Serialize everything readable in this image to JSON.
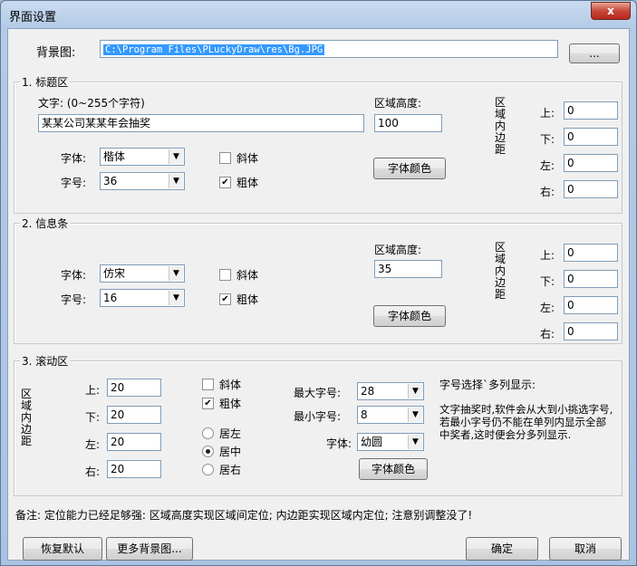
{
  "window": {
    "title": "界面设置",
    "close": "x"
  },
  "background": {
    "label": "背景图:",
    "path": "C:\\Program Files\\PLuckyDraw\\res\\Bg.JPG",
    "browse": "..."
  },
  "title_area": {
    "group": "1. 标题区",
    "text_label": "文字: (0~255个字符)",
    "text_value": "某某公司某某年会抽奖",
    "height_label": "区域高度:",
    "height_value": "100",
    "font_label": "字体:",
    "font_value": "楷体",
    "size_label": "字号:",
    "size_value": "36",
    "italic": "斜体",
    "bold": "粗体",
    "italic_checked": false,
    "bold_checked": true,
    "color_button": "字体颜色",
    "padding_label": "区域内边距",
    "pad_top_label": "上:",
    "pad_top": "0",
    "pad_bottom_label": "下:",
    "pad_bottom": "0",
    "pad_left_label": "左:",
    "pad_left": "0",
    "pad_right_label": "右:",
    "pad_right": "0"
  },
  "info_bar": {
    "group": "2. 信息条",
    "height_label": "区域高度:",
    "height_value": "35",
    "font_label": "字体:",
    "font_value": "仿宋",
    "size_label": "字号:",
    "size_value": "16",
    "italic": "斜体",
    "bold": "粗体",
    "italic_checked": false,
    "bold_checked": true,
    "color_button": "字体颜色",
    "padding_label": "区域内边距",
    "pad_top_label": "上:",
    "pad_top": "0",
    "pad_bottom_label": "下:",
    "pad_bottom": "0",
    "pad_left_label": "左:",
    "pad_left": "0",
    "pad_right_label": "右:",
    "pad_right": "0"
  },
  "scroll_area": {
    "group": "3. 滚动区",
    "padding_label": "区域内边距",
    "pad_top_label": "上:",
    "pad_top": "20",
    "pad_bottom_label": "下:",
    "pad_bottom": "20",
    "pad_left_label": "左:",
    "pad_left": "20",
    "pad_right_label": "右:",
    "pad_right": "20",
    "italic": "斜体",
    "bold": "粗体",
    "italic_checked": false,
    "bold_checked": true,
    "align_left": "居左",
    "align_center": "居中",
    "align_right": "居右",
    "align_selected": "居中",
    "max_size_label": "最大字号:",
    "max_size_value": "28",
    "min_size_label": "最小字号:",
    "min_size_value": "8",
    "font_label": "字体:",
    "font_value": "幼圆",
    "color_button": "字体颜色",
    "hint_title": "字号选择`多列显示:",
    "hint_text": "文字抽奖时,软件会从大到小挑选字号,若最小字号仍不能在单列内显示全部中奖者,这时便会分多列显示."
  },
  "footer": {
    "note": "备注: 定位能力已经足够强: 区域高度实现区域间定位; 内边距实现区域内定位; 注意别调整没了!",
    "restore_button": "恢复默认",
    "more_bg_button": "更多背景图...",
    "ok_button": "确定",
    "cancel_button": "取消"
  }
}
